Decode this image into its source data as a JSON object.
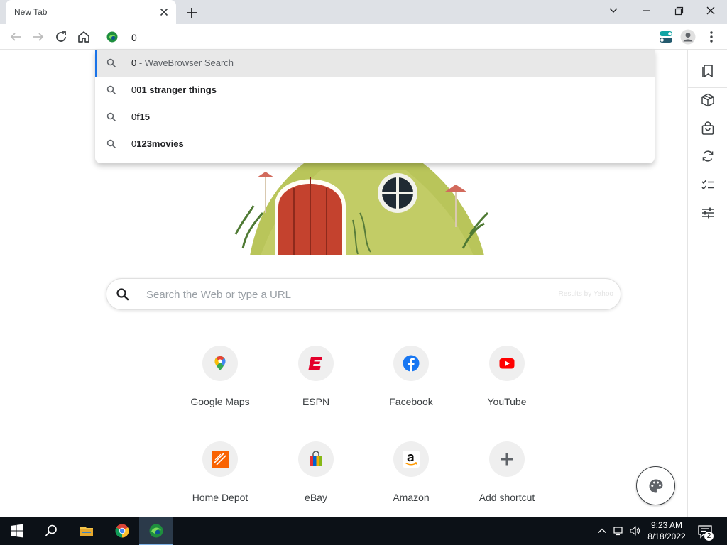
{
  "window": {
    "tab_title": "New Tab"
  },
  "omnibox": {
    "value": "0",
    "suggestions": [
      {
        "typed": "0",
        "completion": "",
        "separator": " - ",
        "provider": "WaveBrowser Search",
        "selected": true
      },
      {
        "typed": "0",
        "completion": "01 stranger things",
        "separator": "",
        "provider": "",
        "selected": false
      },
      {
        "typed": "0",
        "completion": "f15",
        "separator": "",
        "provider": "",
        "selected": false
      },
      {
        "typed": "0",
        "completion": "123movies",
        "separator": "",
        "provider": "",
        "selected": false
      }
    ]
  },
  "search": {
    "placeholder": "Search the Web or type a URL",
    "results_by": "Results by Yahoo"
  },
  "shortcuts": [
    {
      "label": "Google Maps",
      "icon": "map-pin-icon"
    },
    {
      "label": "ESPN",
      "icon": "espn-logo-icon"
    },
    {
      "label": "Facebook",
      "icon": "facebook-icon"
    },
    {
      "label": "YouTube",
      "icon": "youtube-icon"
    },
    {
      "label": "Home Depot",
      "icon": "home-depot-icon"
    },
    {
      "label": "eBay",
      "icon": "shopping-bag-icon"
    },
    {
      "label": "Amazon",
      "icon": "amazon-icon"
    },
    {
      "label": "Add shortcut",
      "icon": "plus-icon"
    }
  ],
  "taskbar": {
    "time": "9:23 AM",
    "date": "8/18/2022",
    "notification_count": "2"
  },
  "colors": {
    "accent": "#1a73e8",
    "tabstrip": "#dee1e6",
    "taskbar": "#0c1117",
    "espn_red": "#e4002b",
    "youtube_red": "#ff0000",
    "facebook_blue": "#1877f2",
    "home_depot_orange": "#f96302"
  }
}
